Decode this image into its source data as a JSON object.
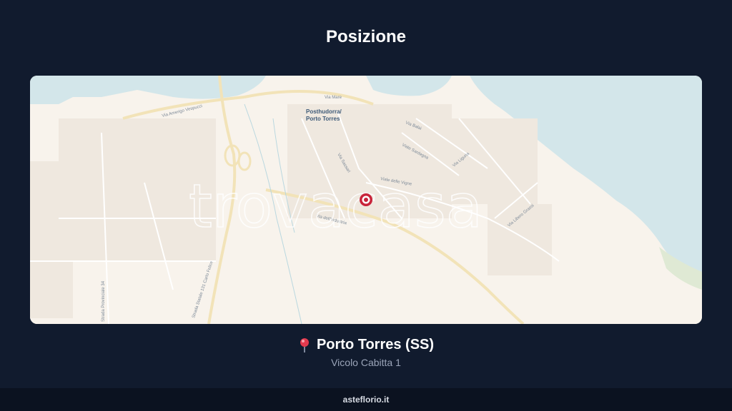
{
  "page": {
    "title": "Posizione"
  },
  "map": {
    "watermark": "trovacasa",
    "places": [
      {
        "name": "Posthudorra/"
      },
      {
        "name": "Porto Torres"
      }
    ],
    "streets": [
      "Via Mare",
      "Via Amerigo Vespucci",
      "Via Sassari",
      "Via dell'Industria",
      "Viale delle Vigne",
      "Via Balai",
      "Viale Sardegna",
      "Via Liguria",
      "Via Libero Grassi",
      "Strada Statale 131 Carlo Felice",
      "Strada Provinciale 34"
    ],
    "marker": "location-marker"
  },
  "location": {
    "city": "Porto Torres (SS)",
    "address": "Vicolo Cabitta 1"
  },
  "footer": {
    "site": "asteflorio.it"
  },
  "colors": {
    "background": "#111b2e",
    "footer": "#0b1220",
    "pin": "#e23a4e",
    "sea": "#d3e6ea",
    "land": "#f8f3ec"
  }
}
